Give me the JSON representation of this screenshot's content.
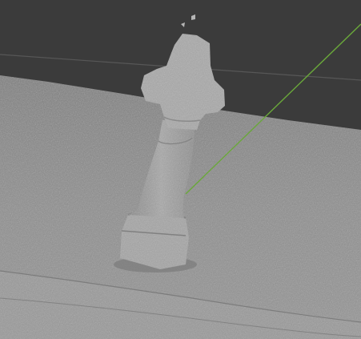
{
  "app": {
    "type": "3d-viewport",
    "background_color": "#3b3b3b"
  },
  "scene": {
    "object": "cross-monument-scan",
    "mesh_color": "#9a9a9a",
    "ground_color": "#8c8c8c",
    "axis_line_color": "#6aa83a",
    "horizon_line_color": "#5a5a5a"
  }
}
